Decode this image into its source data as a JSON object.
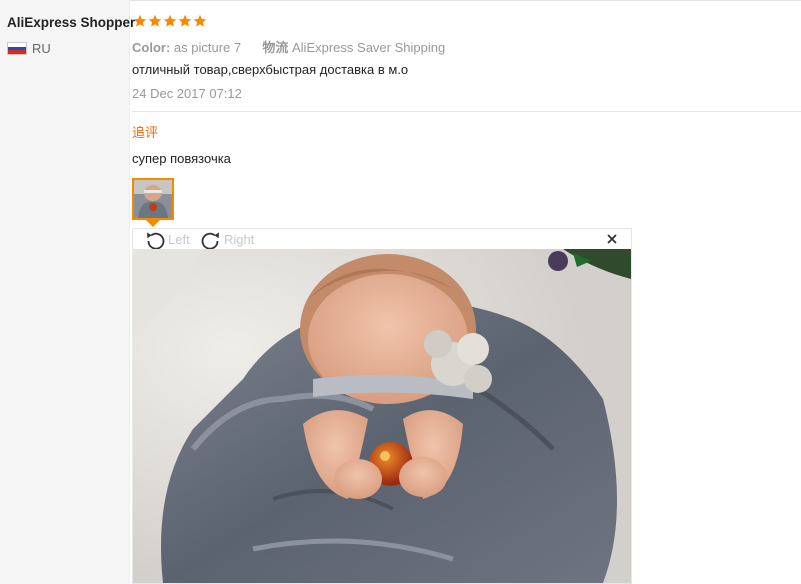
{
  "buyer": {
    "name": "AliExpress Shopper",
    "country_code": "RU",
    "flag": "russia-flag-icon"
  },
  "rating": {
    "stars": 5,
    "max": 5,
    "color": "#f58a00"
  },
  "review": {
    "color_label": "Color:",
    "color_value": "as picture 7",
    "shipping_label": "物流",
    "shipping_value": "AliExpress Saver Shipping",
    "text": "отличный товар,сверхбыстрая доставка в м.о",
    "date": "24 Dec 2017 07:12"
  },
  "followup": {
    "label": "追评",
    "text": "супер повязочка",
    "accent": "#f56600"
  },
  "viewer": {
    "rotate_left_label": "Left",
    "rotate_right_label": "Right",
    "close_icon": "close-icon"
  }
}
